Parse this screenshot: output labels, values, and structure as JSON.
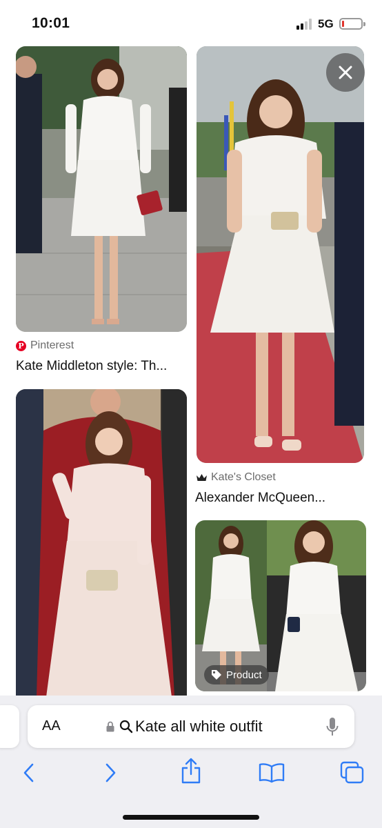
{
  "status_bar": {
    "time": "10:01",
    "network": "5G",
    "battery_level": 0.12
  },
  "results": [
    {
      "source": "Pinterest",
      "source_icon": "pinterest-icon",
      "title": "Kate Middleton style: Th..."
    },
    {
      "source": "Kate's Closet",
      "source_icon": "crown-icon",
      "title": "Alexander McQueen..."
    }
  ],
  "product_badge": {
    "label": "Product",
    "icon": "tag-icon"
  },
  "address_bar": {
    "text_size_label": "AA",
    "query": "Kate all white outfit"
  },
  "toolbar": {
    "buttons": [
      "back-icon",
      "forward-icon",
      "share-icon",
      "bookmarks-icon",
      "tabs-icon"
    ]
  },
  "colors": {
    "accent": "#2f7cf6",
    "pinterest": "#e60023",
    "red_carpet": "#c0404a",
    "toolbar_bg": "#efeff3"
  }
}
